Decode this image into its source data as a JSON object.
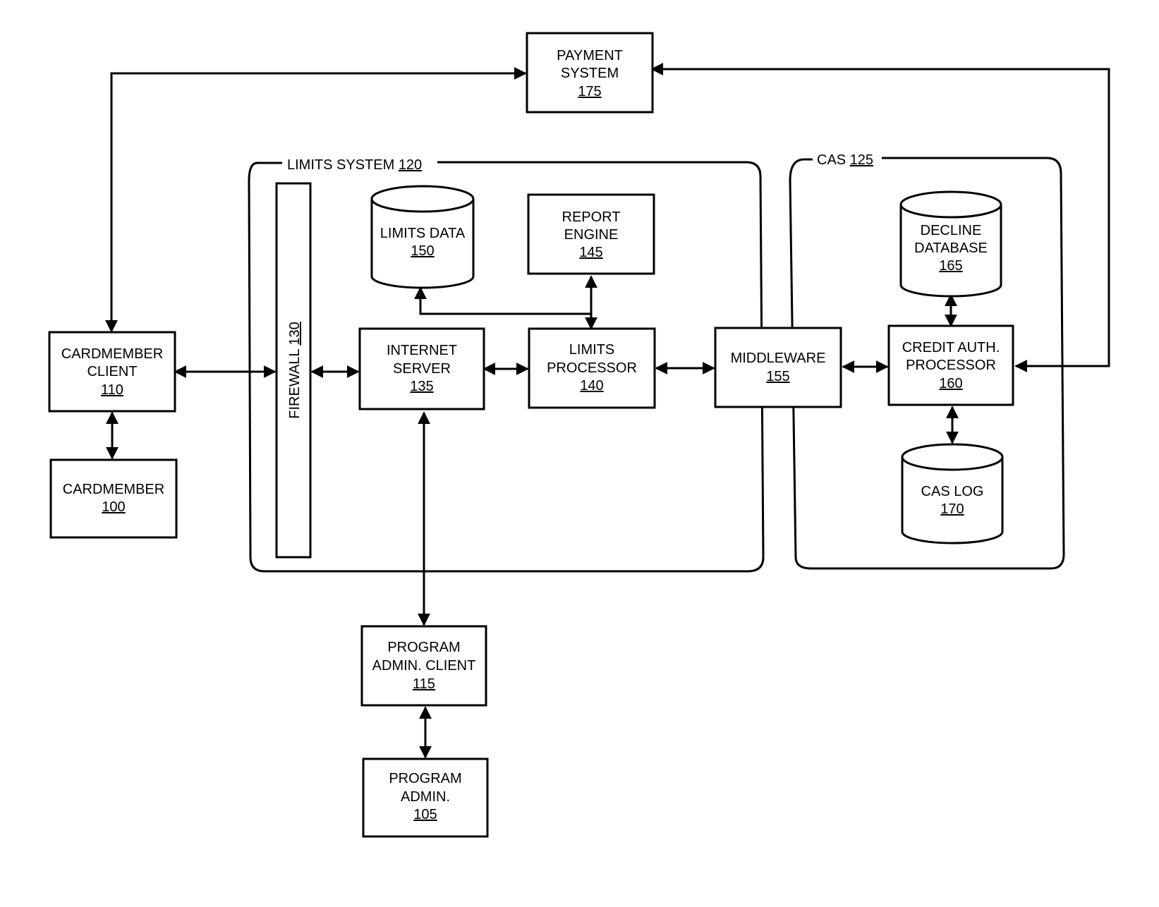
{
  "diagram": {
    "type": "system-block-diagram",
    "colors": {
      "stroke": "#000000",
      "background": "#ffffff"
    },
    "groups": [
      {
        "id": "limits-system",
        "name": "LIMITS SYSTEM",
        "ref": "120"
      },
      {
        "id": "cas",
        "name": "CAS",
        "ref": "125"
      }
    ],
    "nodes": {
      "payment_system": {
        "lines": [
          "PAYMENT",
          "SYSTEM"
        ],
        "ref": "175",
        "shape": "box"
      },
      "cardmember_client": {
        "lines": [
          "CARDMEMBER",
          "CLIENT"
        ],
        "ref": "110",
        "shape": "box"
      },
      "cardmember": {
        "lines": [
          "CARDMEMBER"
        ],
        "ref": "100",
        "shape": "box"
      },
      "firewall": {
        "lines": [
          "FIREWALL"
        ],
        "ref": "130",
        "shape": "vertical-bar"
      },
      "limits_data": {
        "lines": [
          "LIMITS DATA"
        ],
        "ref": "150",
        "shape": "cylinder"
      },
      "report_engine": {
        "lines": [
          "REPORT",
          "ENGINE"
        ],
        "ref": "145",
        "shape": "box"
      },
      "internet_server": {
        "lines": [
          "INTERNET",
          "SERVER"
        ],
        "ref": "135",
        "shape": "box"
      },
      "limits_processor": {
        "lines": [
          "LIMITS",
          "PROCESSOR"
        ],
        "ref": "140",
        "shape": "box"
      },
      "middleware": {
        "lines": [
          "MIDDLEWARE"
        ],
        "ref": "155",
        "shape": "box"
      },
      "decline_database": {
        "lines": [
          "DECLINE",
          "DATABASE"
        ],
        "ref": "165",
        "shape": "cylinder"
      },
      "credit_auth_processor": {
        "lines": [
          "CREDIT AUTH.",
          "PROCESSOR"
        ],
        "ref": "160",
        "shape": "box"
      },
      "cas_log": {
        "lines": [
          "CAS LOG"
        ],
        "ref": "170",
        "shape": "cylinder"
      },
      "program_admin_client": {
        "lines": [
          "PROGRAM",
          "ADMIN. CLIENT"
        ],
        "ref": "115",
        "shape": "box"
      },
      "program_admin": {
        "lines": [
          "PROGRAM",
          "ADMIN."
        ],
        "ref": "105",
        "shape": "box"
      }
    },
    "edges": [
      {
        "from": "cardmember_client",
        "to": "payment_system",
        "direction": "both"
      },
      {
        "from": "credit_auth_processor",
        "to": "payment_system",
        "direction": "both"
      },
      {
        "from": "cardmember_client",
        "to": "firewall",
        "direction": "both"
      },
      {
        "from": "cardmember_client",
        "to": "cardmember",
        "direction": "both"
      },
      {
        "from": "firewall",
        "to": "internet_server",
        "direction": "both"
      },
      {
        "from": "internet_server",
        "to": "limits_processor",
        "direction": "both"
      },
      {
        "from": "limits_processor",
        "to": "report_engine",
        "direction": "both"
      },
      {
        "from": "limits_processor",
        "to": "limits_data",
        "direction": "to"
      },
      {
        "from": "limits_processor",
        "to": "middleware",
        "direction": "both"
      },
      {
        "from": "middleware",
        "to": "credit_auth_processor",
        "direction": "both"
      },
      {
        "from": "credit_auth_processor",
        "to": "decline_database",
        "direction": "both"
      },
      {
        "from": "credit_auth_processor",
        "to": "cas_log",
        "direction": "both"
      },
      {
        "from": "internet_server",
        "to": "program_admin_client",
        "direction": "both"
      },
      {
        "from": "program_admin_client",
        "to": "program_admin",
        "direction": "both"
      }
    ]
  }
}
